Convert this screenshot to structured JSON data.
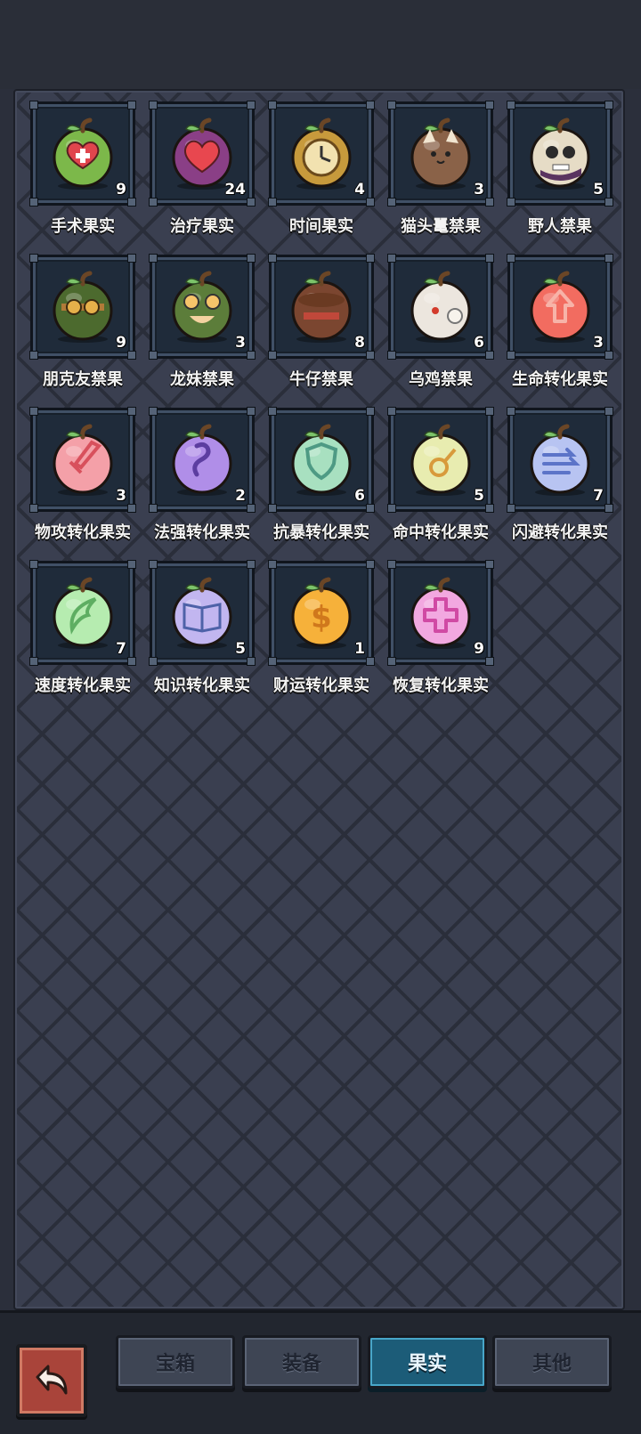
{
  "items": [
    {
      "name": "手术果实",
      "count": "9",
      "icon": "surgery-fruit-icon",
      "color": "#7cb84a",
      "accent": "#e0454d",
      "glyph": "heart-plus"
    },
    {
      "name": "治疗果实",
      "count": "24",
      "icon": "healing-fruit-icon",
      "color": "#8a3f86",
      "accent": "#e8474f",
      "glyph": "heart"
    },
    {
      "name": "时间果实",
      "count": "4",
      "icon": "time-fruit-icon",
      "color": "#c79a3c",
      "accent": "#f2e2b0",
      "glyph": "clock"
    },
    {
      "name": "猫头鼍禁果",
      "count": "3",
      "icon": "cat-fruit-icon",
      "color": "#8a6248",
      "accent": "#f1e5d0",
      "glyph": "cat"
    },
    {
      "name": "野人禁果",
      "count": "5",
      "icon": "skull-fruit-icon",
      "color": "#e6dcc6",
      "accent": "#5a3460",
      "glyph": "skull"
    },
    {
      "name": "朋克友禁果",
      "count": "9",
      "icon": "punk-fruit-icon",
      "color": "#4c6a2e",
      "accent": "#b27a38",
      "glyph": "goggles"
    },
    {
      "name": "龙妹禁果",
      "count": "3",
      "icon": "dragon-fruit-icon",
      "color": "#5c7d3a",
      "accent": "#f6c46a",
      "glyph": "dragon"
    },
    {
      "name": "牛仔禁果",
      "count": "8",
      "icon": "cowboy-fruit-icon",
      "color": "#7b4630",
      "accent": "#c0483a",
      "glyph": "hat"
    },
    {
      "name": "乌鸡禁果",
      "count": "6",
      "icon": "chicken-fruit-icon",
      "color": "#ece6de",
      "accent": "#d33b2c",
      "glyph": "chicken"
    },
    {
      "name": "生命转化果实",
      "count": "3",
      "icon": "life-fruit-icon",
      "color": "#f26c60",
      "accent": "#f7b3a8",
      "glyph": "arrow-up"
    },
    {
      "name": "物攻转化果实",
      "count": "3",
      "icon": "attack-fruit-icon",
      "color": "#f4a0a8",
      "accent": "#d8505c",
      "glyph": "sword"
    },
    {
      "name": "法强转化果实",
      "count": "2",
      "icon": "magic-fruit-icon",
      "color": "#b08ee8",
      "accent": "#5c3da0",
      "glyph": "swirl"
    },
    {
      "name": "抗暴转化果实",
      "count": "6",
      "icon": "crit-resist-fruit-icon",
      "color": "#a8e0c0",
      "accent": "#4e9a84",
      "glyph": "shield"
    },
    {
      "name": "命中转化果实",
      "count": "5",
      "icon": "accuracy-fruit-icon",
      "color": "#e8ecb0",
      "accent": "#d89a3c",
      "glyph": "target"
    },
    {
      "name": "闪避转化果实",
      "count": "7",
      "icon": "dodge-fruit-icon",
      "color": "#b8c4f2",
      "accent": "#5c74c8",
      "glyph": "wind"
    },
    {
      "name": "速度转化果实",
      "count": "7",
      "icon": "speed-fruit-icon",
      "color": "#b6ecb0",
      "accent": "#5eae62",
      "glyph": "wing"
    },
    {
      "name": "知识转化果实",
      "count": "5",
      "icon": "knowledge-fruit-icon",
      "color": "#c2b6f0",
      "accent": "#4e62a8",
      "glyph": "book"
    },
    {
      "name": "财运转化果实",
      "count": "1",
      "icon": "wealth-fruit-icon",
      "color": "#f6b13a",
      "accent": "#d0781c",
      "glyph": "dollar"
    },
    {
      "name": "恢复转化果实",
      "count": "9",
      "icon": "recovery-fruit-icon",
      "color": "#f2a8e0",
      "accent": "#d04aa4",
      "glyph": "plus"
    }
  ],
  "tabs": [
    {
      "label": "宝箱",
      "active": false
    },
    {
      "label": "装备",
      "active": false
    },
    {
      "label": "果实",
      "active": true
    },
    {
      "label": "其他",
      "active": false
    }
  ],
  "back_icon": "back-arrow-icon"
}
